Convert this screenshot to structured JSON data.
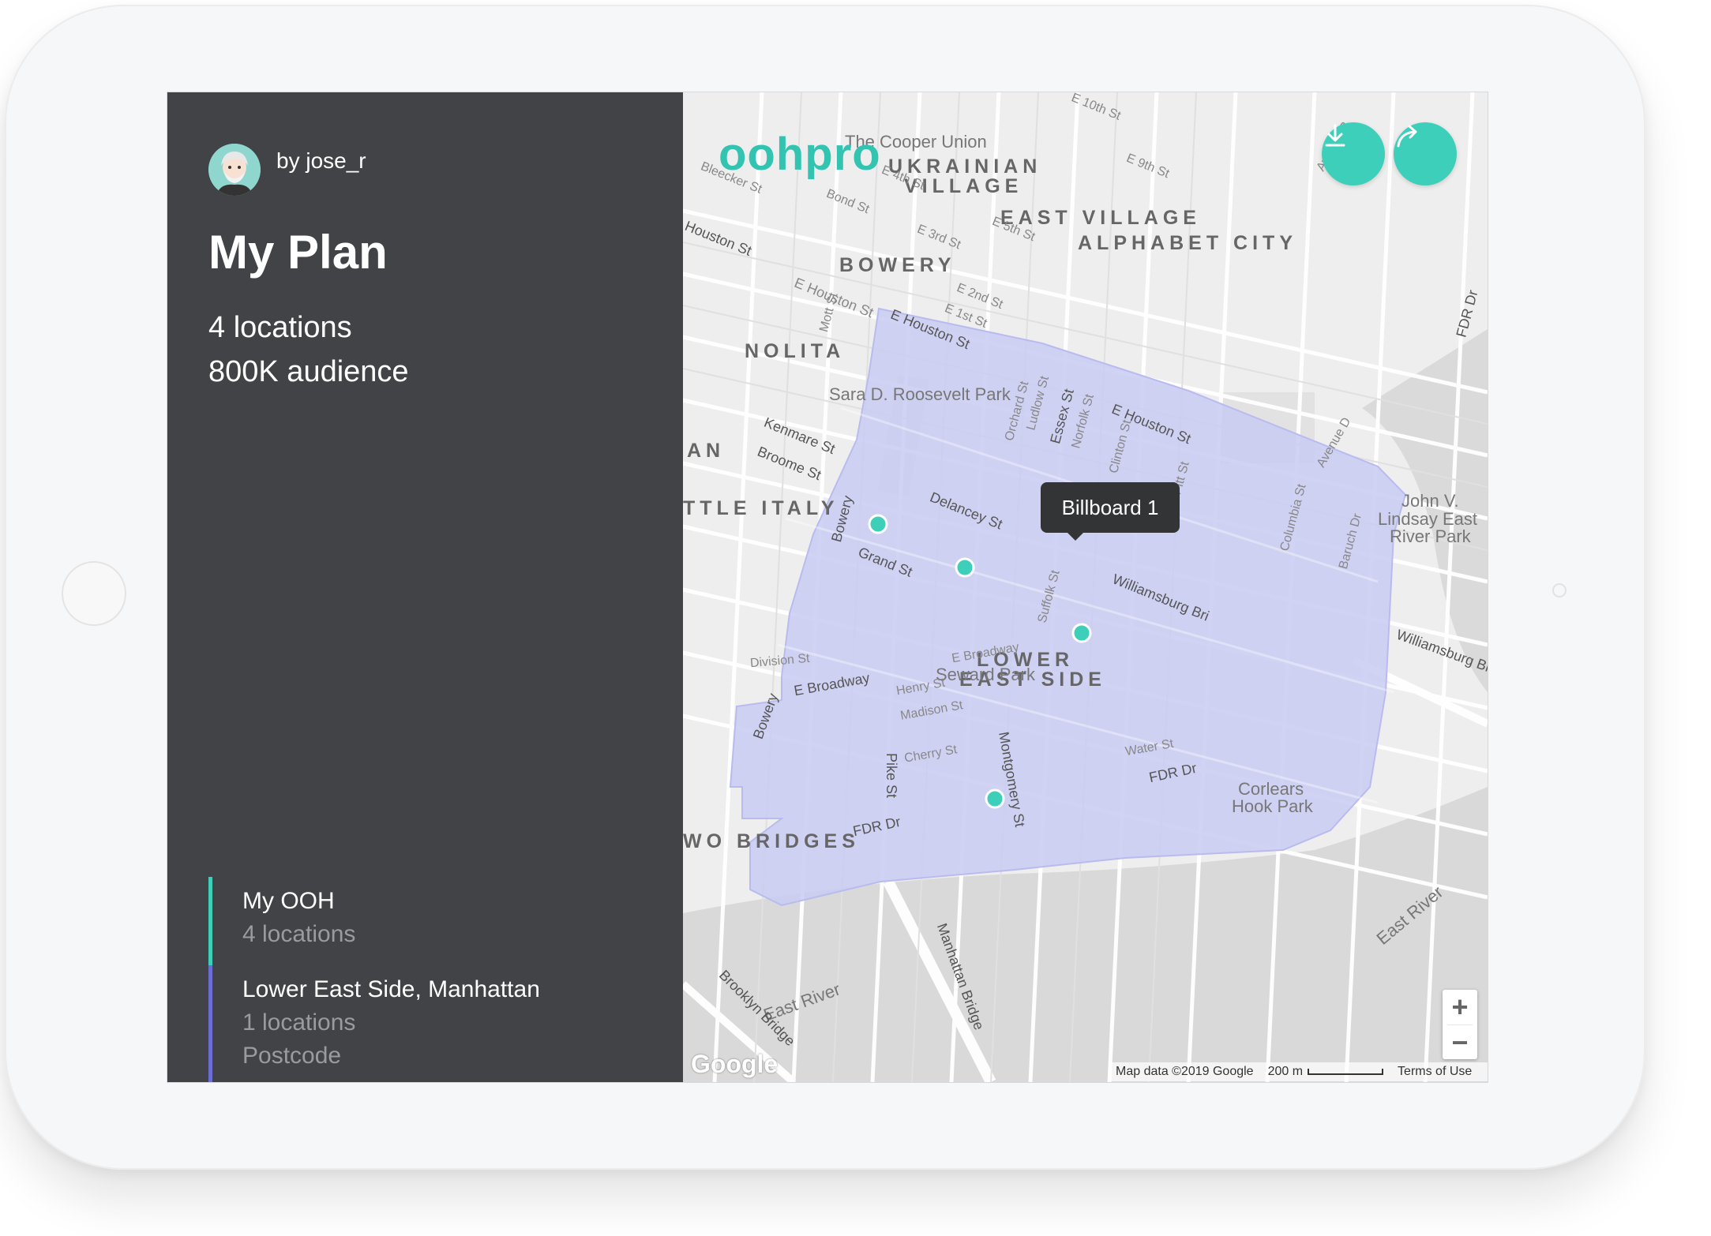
{
  "sidebar": {
    "author": "by jose_r",
    "title": "My Plan",
    "stats": {
      "locations": "4 locations",
      "audience": "800K audience"
    },
    "layers": [
      {
        "title": "My OOH",
        "lines": [
          "4 locations"
        ],
        "color": "#3ecfbb"
      },
      {
        "title": "Lower East Side, Manhattan",
        "lines": [
          "1 locations",
          "Postcode"
        ],
        "color": "#6b6fd4"
      }
    ]
  },
  "map": {
    "logo": "oohpro",
    "download_icon": "download-icon",
    "share_icon": "share-icon",
    "tooltip": "Billboard 1",
    "markers_color": "#3ecfbb",
    "area_color": "#c9cbf3",
    "zoom_in": "+",
    "zoom_out": "−",
    "google": "Google",
    "attribution": {
      "map_data": "Map data ©2019 Google",
      "scale": "200 m",
      "terms": "Terms of Use"
    },
    "area_labels": [
      "UKRAINIAN",
      "VILLAGE",
      "EAST VILLAGE",
      "ALPHABET CITY",
      "BOWERY",
      "NOLITA",
      "LOWER",
      "EAST SIDE",
      "TTLE ITALY",
      "AN",
      "WO BRIDGES"
    ],
    "place_labels": [
      "The Cooper Union",
      "Sara D. Roosevelt Park",
      "Seward Park",
      "John V.",
      "Lindsay East",
      "River Park",
      "Corlears",
      "Hook Park",
      "East River",
      "East River"
    ],
    "street_labels": [
      "E Houston St",
      "E Houston St",
      "E Houston St",
      "Delancey St",
      "Grand St",
      "Kenmare St",
      "Broome St",
      "Williamsburg Bri",
      "Williamsburg Brid",
      "E Broadway",
      "E Broadway",
      "Division St",
      "Henry St",
      "Madison St",
      "Cherry St",
      "Water St",
      "FDR Dr",
      "FDR Dr",
      "Pike St",
      "Montgomery St",
      "Bowery",
      "Bowery",
      "Essex St",
      "Norfolk St",
      "Suffolk St",
      "Clinton St",
      "Orchard St",
      "Ludlow St",
      "Pitt St",
      "Columbia St",
      "Baruch Dr",
      "E 10th St",
      "E 9th St",
      "E 4th St",
      "E 5th St",
      "E 3rd St",
      "E 2nd St",
      "E 1st St",
      "Bond St",
      "Bleecker St",
      "Houston St",
      "Mott St",
      "Manhattan Bridge",
      "Brooklyn Bridge",
      "Avenue B",
      "Avenue D",
      "FDR Dr"
    ]
  }
}
